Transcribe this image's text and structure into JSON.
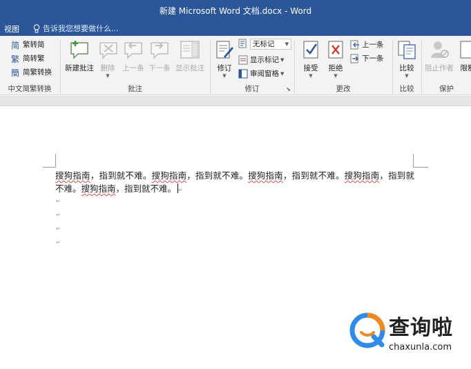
{
  "window": {
    "title": "新建 Microsoft Word 文档.docx - Word"
  },
  "tabs": {
    "view": "视图",
    "tell_me": "告诉我您想要做什么..."
  },
  "ribbon": {
    "chinese_convert": {
      "trad_to_simp": "繁转简",
      "simp_to_trad": "简转繁",
      "convert": "简繁转换",
      "group_label": "中文简繁转换"
    },
    "comments": {
      "new_comment": "新建批注",
      "delete": "删除",
      "previous": "上一条",
      "next": "下一条",
      "show_comments": "显示批注",
      "group_label": "批注"
    },
    "tracking": {
      "track_changes": "修订",
      "markup_mode": "无标记",
      "show_markup": "显示标记",
      "reviewing_pane": "审阅窗格",
      "group_label": "修订"
    },
    "changes": {
      "accept": "接受",
      "reject": "拒绝",
      "previous": "上一条",
      "next": "下一条",
      "group_label": "更改"
    },
    "compare": {
      "compare": "比较",
      "group_label": "比较"
    },
    "protect": {
      "block_authors": "阻止作者",
      "restrict": "限制",
      "group_label": "保护"
    }
  },
  "document": {
    "seg1": "搜狗指南",
    "sep1": "，指到就不难。",
    "seg2": "搜狗指南",
    "sep2": "，指到就不难。",
    "seg3": "搜狗指南",
    "sep3": "，指到就不难。",
    "seg4": "搜狗指南",
    "sep4": "，指到就不难。",
    "seg5": "搜狗指南",
    "sep5": "，指到就不难。"
  },
  "watermark": {
    "title": "查询啦",
    "sub": "chaxunla.com"
  },
  "colors": {
    "title_bar": "#2b579a",
    "ribbon_bg": "#f3f3f3"
  }
}
